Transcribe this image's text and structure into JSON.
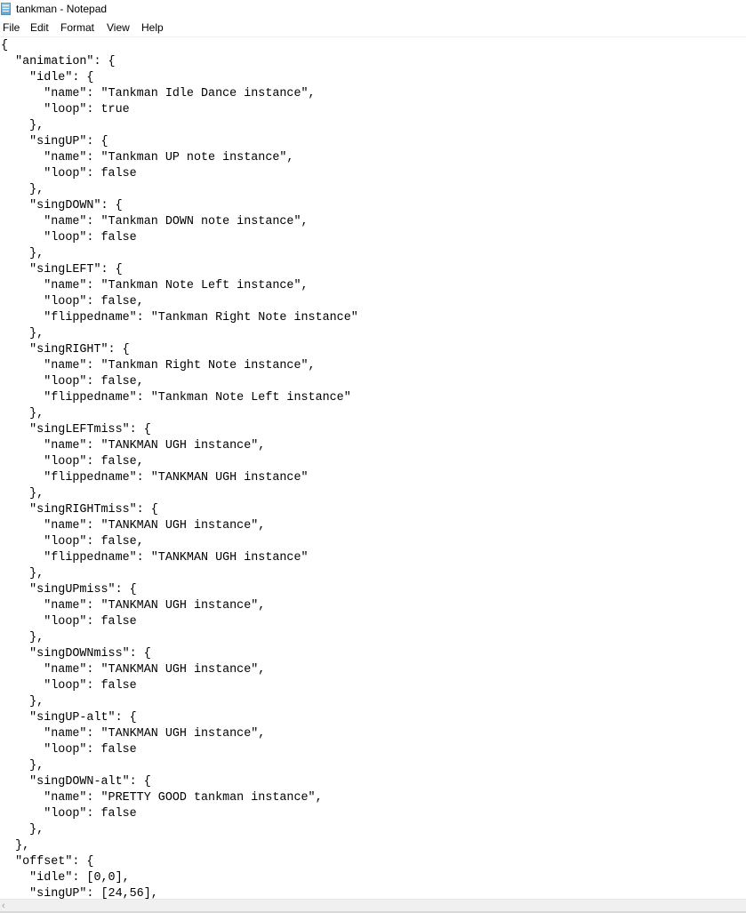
{
  "window": {
    "title": "tankman - Notepad",
    "app_icon": "notepad-icon"
  },
  "menu": {
    "items": [
      "File",
      "Edit",
      "Format",
      "View",
      "Help"
    ]
  },
  "editor": {
    "lines": [
      "{",
      "  \"animation\": {",
      "    \"idle\": {",
      "      \"name\": \"Tankman Idle Dance instance\",",
      "      \"loop\": true",
      "    },",
      "    \"singUP\": {",
      "      \"name\": \"Tankman UP note instance\",",
      "      \"loop\": false",
      "    },",
      "    \"singDOWN\": {",
      "      \"name\": \"Tankman DOWN note instance\",",
      "      \"loop\": false",
      "    },",
      "    \"singLEFT\": {",
      "      \"name\": \"Tankman Note Left instance\",",
      "      \"loop\": false,",
      "      \"flippedname\": \"Tankman Right Note instance\"",
      "    },",
      "    \"singRIGHT\": {",
      "      \"name\": \"Tankman Right Note instance\",",
      "      \"loop\": false,",
      "      \"flippedname\": \"Tankman Note Left instance\"",
      "    },",
      "    \"singLEFTmiss\": {",
      "      \"name\": \"TANKMAN UGH instance\",",
      "      \"loop\": false,",
      "      \"flippedname\": \"TANKMAN UGH instance\"",
      "    },",
      "    \"singRIGHTmiss\": {",
      "      \"name\": \"TANKMAN UGH instance\",",
      "      \"loop\": false,",
      "      \"flippedname\": \"TANKMAN UGH instance\"",
      "    },",
      "    \"singUPmiss\": {",
      "      \"name\": \"TANKMAN UGH instance\",",
      "      \"loop\": false",
      "    },",
      "    \"singDOWNmiss\": {",
      "      \"name\": \"TANKMAN UGH instance\",",
      "      \"loop\": false",
      "    },",
      "    \"singUP-alt\": {",
      "      \"name\": \"TANKMAN UGH instance\",",
      "      \"loop\": false",
      "    },",
      "    \"singDOWN-alt\": {",
      "      \"name\": \"PRETTY GOOD tankman instance\",",
      "      \"loop\": false",
      "    },",
      "  },",
      "  \"offset\": {",
      "    \"idle\": [0,0],",
      "    \"singUP\": [24,56],"
    ]
  },
  "scrollbar": {
    "left_arrow": "‹"
  }
}
